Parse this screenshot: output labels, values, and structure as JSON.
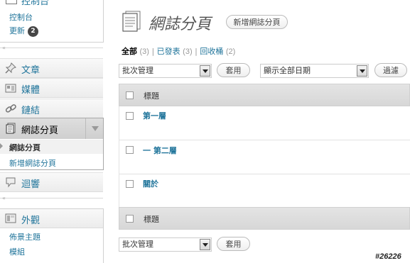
{
  "sidebar": {
    "dashboard_group": {
      "label": "控制台",
      "items": [
        {
          "label": "控制台"
        },
        {
          "label": "更新",
          "badge": "2"
        }
      ]
    },
    "menu": [
      {
        "label": "文章",
        "icon": "pushpin-icon"
      },
      {
        "label": "媒體",
        "icon": "media-icon"
      },
      {
        "label": "鏈結",
        "icon": "link-icon"
      },
      {
        "label": "網誌分頁",
        "icon": "pages-icon",
        "current": true,
        "subitems": [
          {
            "label": "網誌分頁"
          },
          {
            "label": "新增網誌分頁"
          }
        ]
      },
      {
        "label": "迴響",
        "icon": "comment-icon"
      },
      {
        "label": "外觀",
        "icon": "appearance-icon",
        "subitems": [
          {
            "label": "佈景主題"
          },
          {
            "label": "模組"
          }
        ]
      }
    ]
  },
  "main": {
    "page_title": "網誌分頁",
    "add_new_label": "新增網誌分頁",
    "filters": [
      {
        "label": "全部",
        "count": "(3)"
      },
      {
        "label": "已發表",
        "count": "(3)"
      },
      {
        "label": "回收桶",
        "count": "(2)"
      }
    ],
    "filter_separator": "|",
    "bulk_actions": {
      "selected": "批次管理",
      "apply_label": "套用"
    },
    "date_filter": {
      "selected": "顯示全部日期",
      "filter_label": "過濾"
    },
    "table": {
      "column_title": "標題",
      "rows": [
        {
          "title": "第一層"
        },
        {
          "title": "一 第二層"
        },
        {
          "title": "關於"
        }
      ],
      "footer_title": "標題"
    },
    "bottom_bulk": {
      "selected": "批次管理",
      "apply_label": "套用"
    }
  },
  "watermark": "#26226",
  "colors": {
    "link": "#21759b",
    "badge": "#464646",
    "header_bg": "#dfdfdf"
  }
}
